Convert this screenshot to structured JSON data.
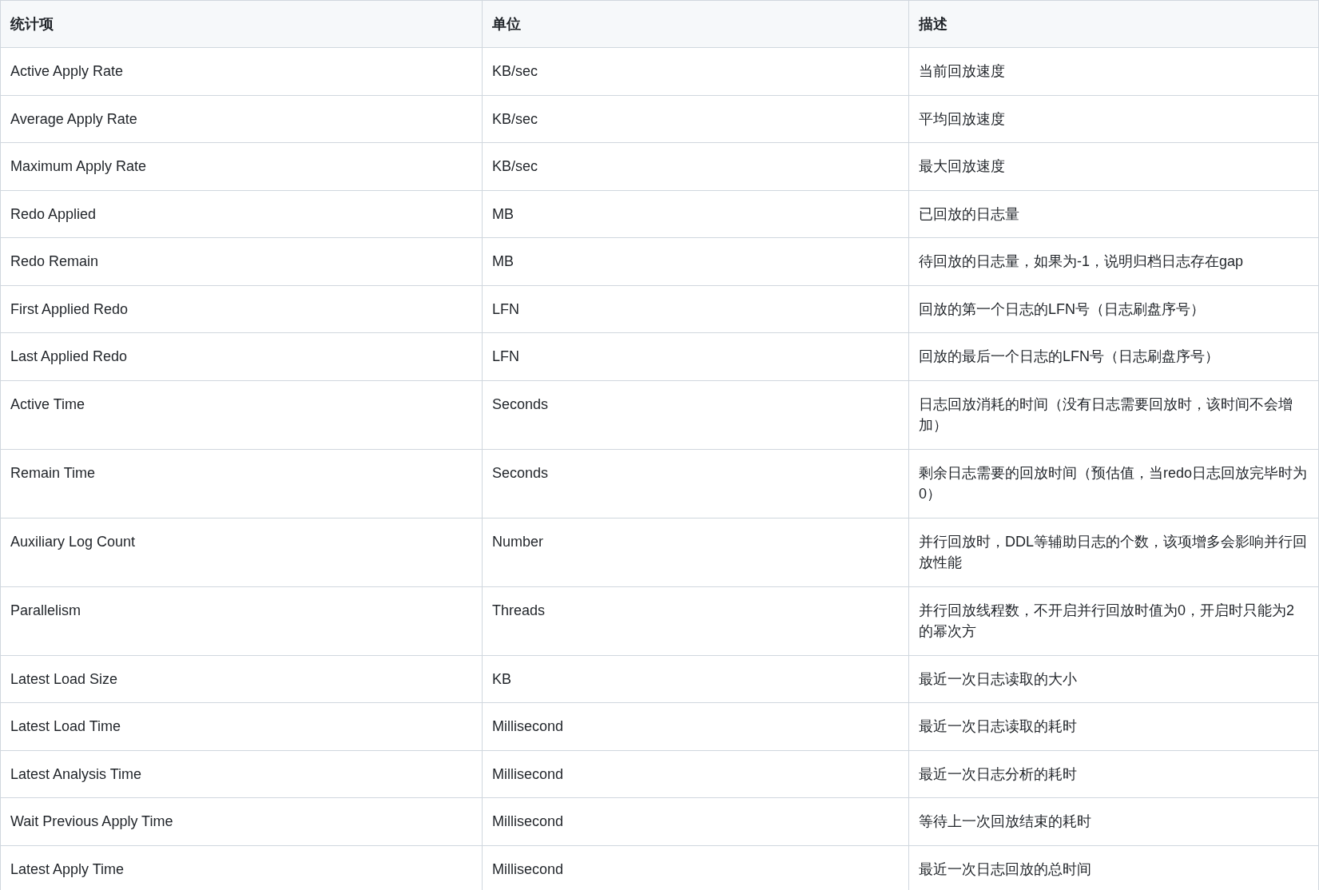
{
  "table": {
    "columns": [
      "统计项",
      "单位",
      "描述"
    ],
    "rows": [
      [
        "Active Apply Rate",
        "KB/sec",
        "当前回放速度"
      ],
      [
        "Average Apply Rate",
        "KB/sec",
        "平均回放速度"
      ],
      [
        "Maximum Apply Rate",
        "KB/sec",
        "最大回放速度"
      ],
      [
        "Redo Applied",
        "MB",
        "已回放的日志量"
      ],
      [
        "Redo Remain",
        "MB",
        "待回放的日志量，如果为-1，说明归档日志存在gap"
      ],
      [
        "First Applied Redo",
        "LFN",
        "回放的第一个日志的LFN号（日志刷盘序号）"
      ],
      [
        "Last Applied Redo",
        "LFN",
        "回放的最后一个日志的LFN号（日志刷盘序号）"
      ],
      [
        "Active Time",
        "Seconds",
        "日志回放消耗的时间（没有日志需要回放时，该时间不会增加）"
      ],
      [
        "Remain Time",
        "Seconds",
        "剩余日志需要的回放时间（预估值，当redo日志回放完毕时为0）"
      ],
      [
        "Auxiliary Log Count",
        "Number",
        "并行回放时，DDL等辅助日志的个数，该项增多会影响并行回放性能"
      ],
      [
        "Parallelism",
        "Threads",
        "并行回放线程数，不开启并行回放时值为0，开启时只能为2的幂次方"
      ],
      [
        "Latest Load Size",
        "KB",
        "最近一次日志读取的大小"
      ],
      [
        "Latest Load Time",
        "Millisecond",
        "最近一次日志读取的耗时"
      ],
      [
        "Latest Analysis Time",
        "Millisecond",
        "最近一次日志分析的耗时"
      ],
      [
        "Wait Previous Apply Time",
        "Millisecond",
        "等待上一次回放结束的耗时"
      ],
      [
        "Latest Apply Time",
        "Millisecond",
        "最近一次日志回放的总时间"
      ]
    ]
  }
}
